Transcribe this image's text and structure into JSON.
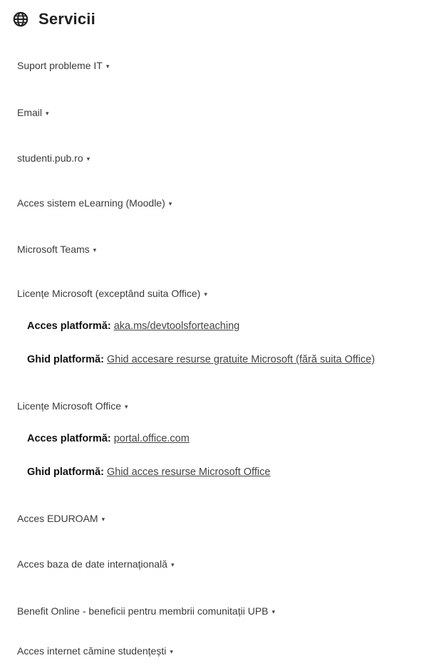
{
  "section": {
    "title": "Servicii",
    "icon": "globe-icon"
  },
  "items": [
    {
      "label": "Suport probleme IT"
    },
    {
      "label": "Email"
    },
    {
      "label": "studenti.pub.ro"
    },
    {
      "label": "Acces sistem eLearning (Moodle)"
    },
    {
      "label": "Microsoft Teams"
    },
    {
      "label": "Licențe Microsoft (exceptând suita Office)"
    },
    {
      "label": "Licențe Microsoft Office"
    },
    {
      "label": "Acces EDUROAM"
    },
    {
      "label": "Acces baza de date internațională"
    },
    {
      "label": "Benefit Online - beneficii pentru membrii comunitații UPB"
    },
    {
      "label": "Acces internet cămine studențești"
    }
  ],
  "caret": "▾",
  "licente_ms": {
    "access_label": "Acces platformă:",
    "access_link": "aka.ms/devtoolsforteaching",
    "guide_label": "Ghid platformă:",
    "guide_link": "Ghid accesare resurse gratuite Microsoft (fără suita Office)"
  },
  "licente_office": {
    "access_label": "Acces platformă:",
    "access_link": "portal.office.com",
    "guide_label": "Ghid platformă:",
    "guide_link": "Ghid acces resurse Microsoft Office"
  }
}
